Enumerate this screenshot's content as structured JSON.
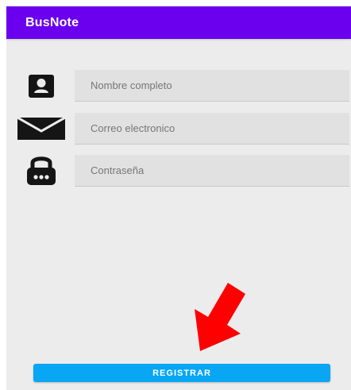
{
  "app": {
    "title": "BusNote",
    "colors": {
      "app_bar": "#6a00ee",
      "background": "#ececec",
      "field": "#e1e1e1",
      "button": "#08a6f3",
      "arrow": "#ff0000"
    }
  },
  "form": {
    "fields": [
      {
        "icon": "account-box-icon",
        "placeholder": "Nombre completo"
      },
      {
        "icon": "mail-icon",
        "placeholder": "Correo electronico"
      },
      {
        "icon": "lock-icon",
        "placeholder": "Contraseña"
      }
    ],
    "button_label": "REGISTRAR"
  },
  "annotation": {
    "icon": "red-arrow-icon"
  }
}
